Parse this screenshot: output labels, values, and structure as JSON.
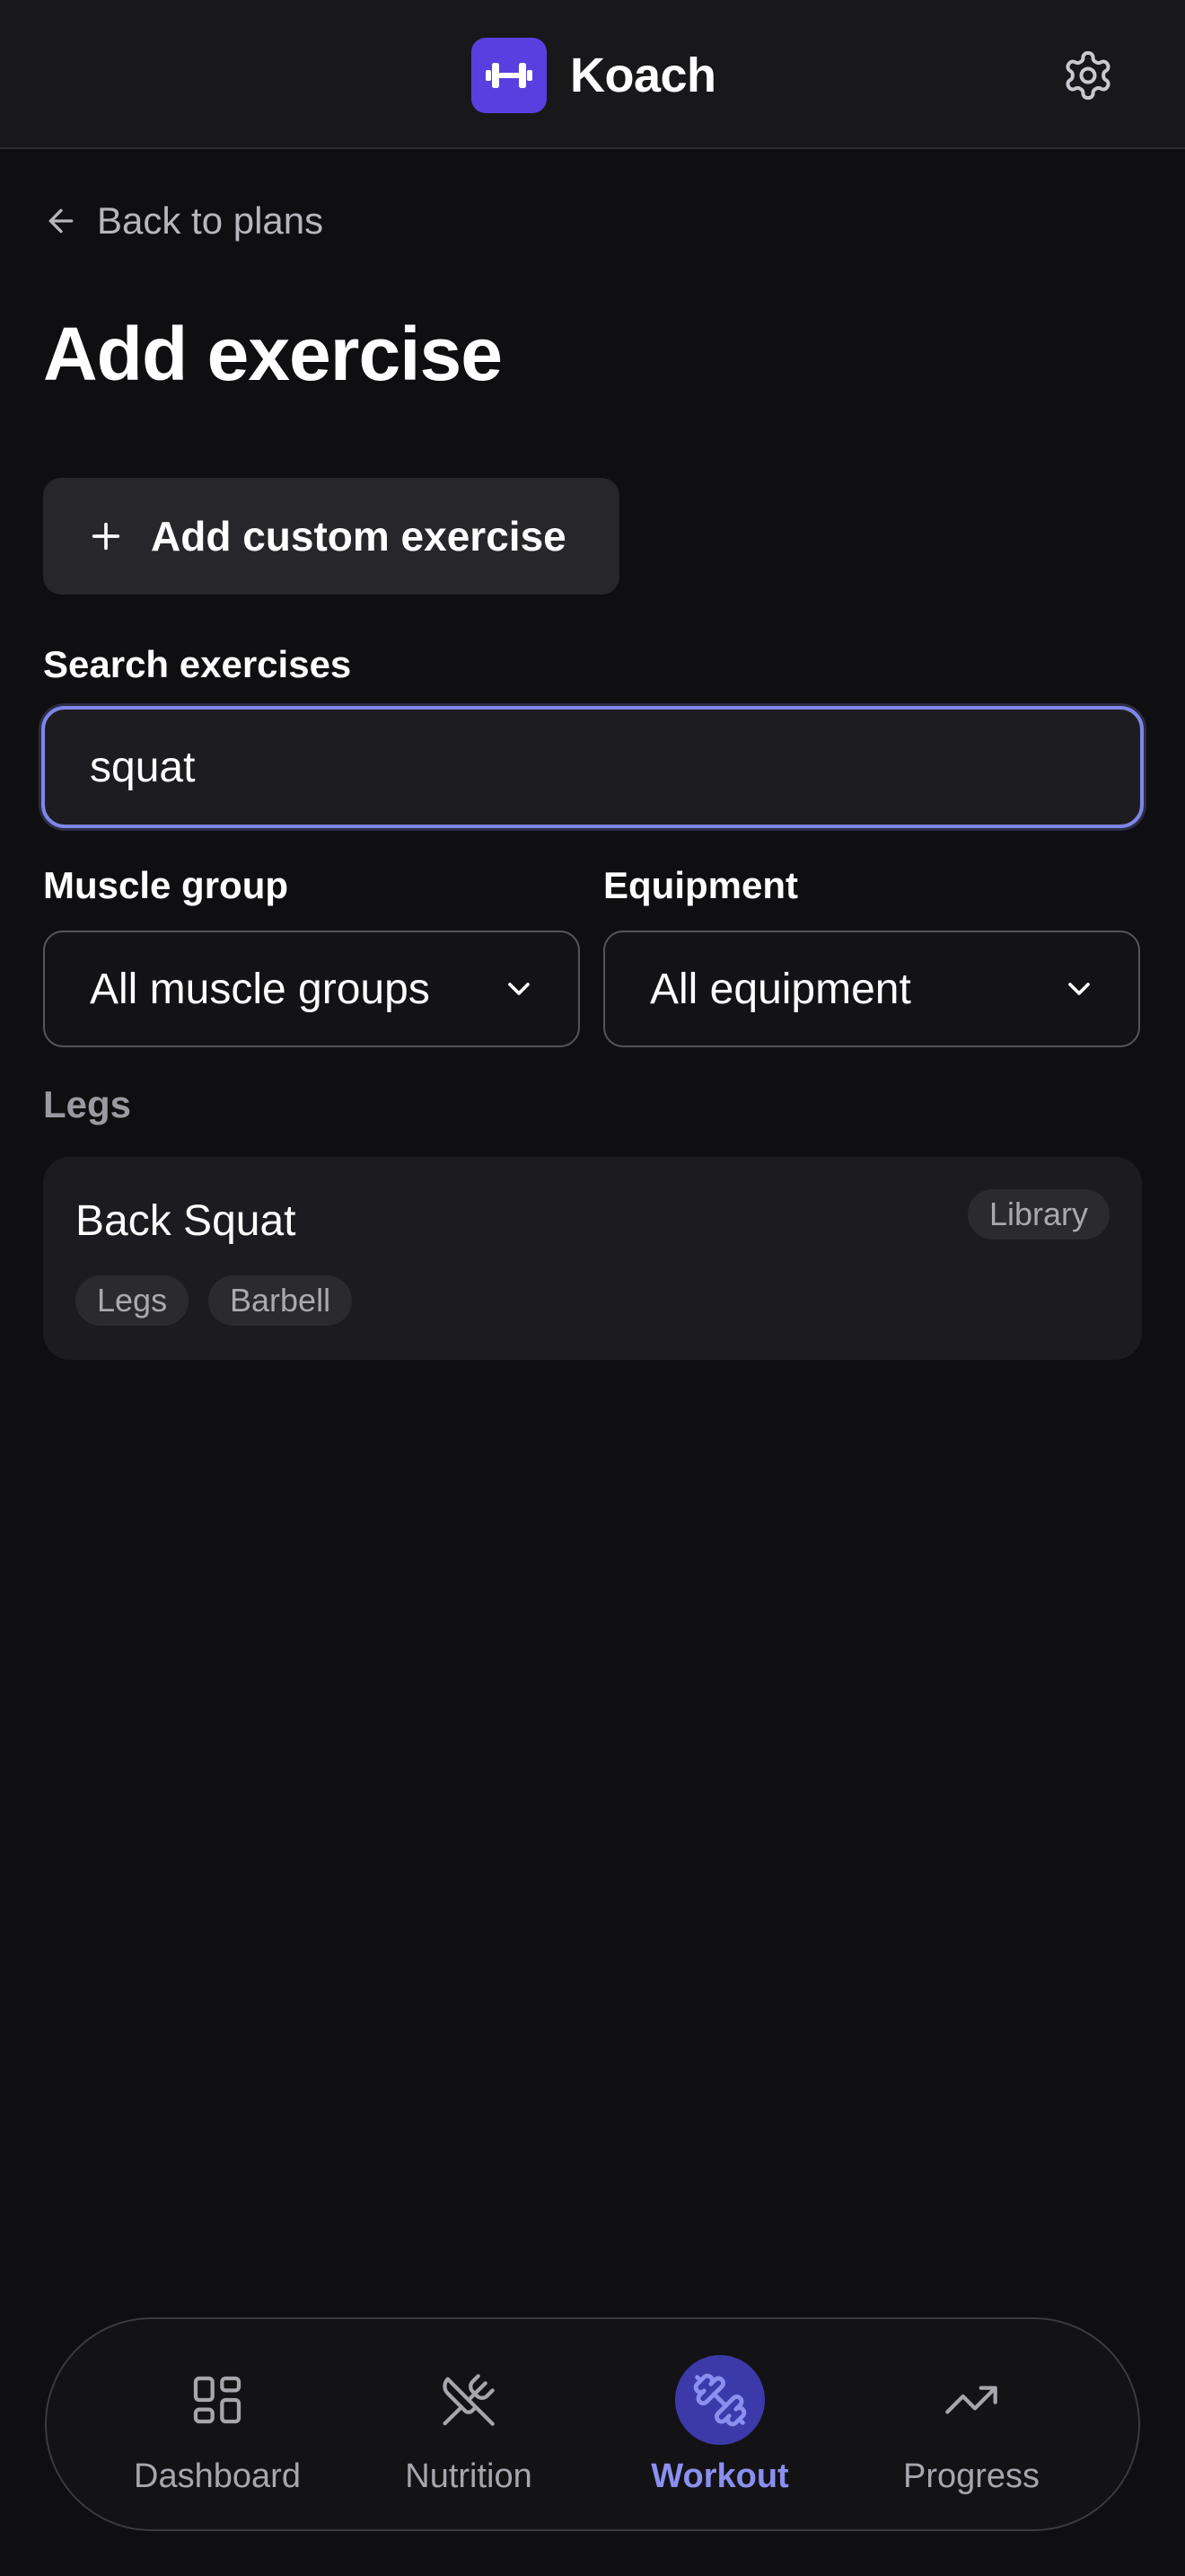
{
  "header": {
    "app_name": "Koach",
    "logo_icon": "dumbbell-icon",
    "settings_icon": "gear-icon"
  },
  "nav": {
    "back_label": "Back to plans"
  },
  "page": {
    "title": "Add exercise",
    "add_custom_label": "Add custom exercise"
  },
  "search": {
    "label": "Search exercises",
    "value": "squat"
  },
  "filters": {
    "muscle_group": {
      "label": "Muscle group",
      "value": "All muscle groups"
    },
    "equipment": {
      "label": "Equipment",
      "value": "All equipment"
    }
  },
  "results": {
    "section_title": "Legs",
    "items": [
      {
        "name": "Back Squat",
        "source": "Library",
        "tags": [
          "Legs",
          "Barbell"
        ]
      }
    ]
  },
  "tabbar": {
    "active": "Workout",
    "accent": "#8b8ff0",
    "items": [
      {
        "label": "Dashboard",
        "icon": "dashboard-icon"
      },
      {
        "label": "Nutrition",
        "icon": "utensils-icon"
      },
      {
        "label": "Workout",
        "icon": "dumbbell-icon"
      },
      {
        "label": "Progress",
        "icon": "trending-up-icon"
      }
    ]
  }
}
